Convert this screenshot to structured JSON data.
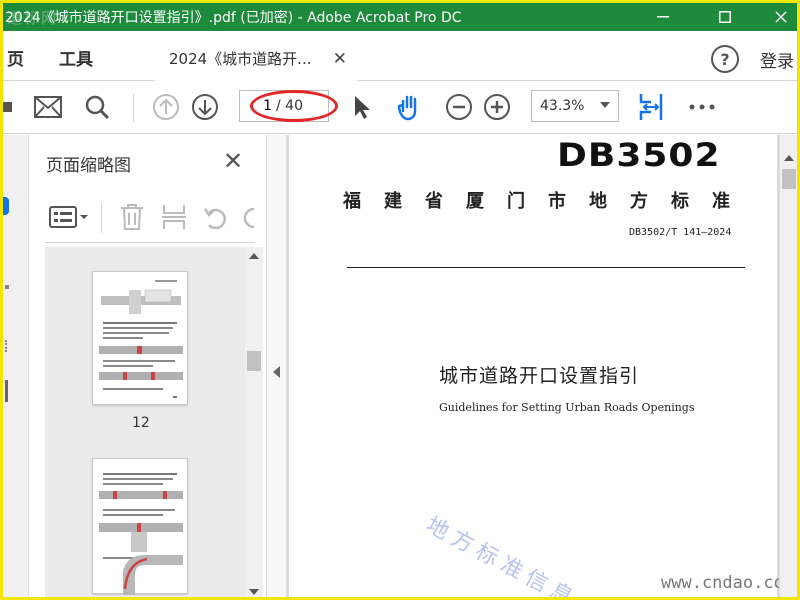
{
  "window": {
    "title": "2024《城市道路开口设置指引》.pdf  (已加密)  - Adobe Acrobat Pro DC",
    "watermark": "道标网"
  },
  "menu": {
    "items": [
      "页",
      "工具"
    ],
    "tab_label": "2024《城市道路开...",
    "login_label": "登录",
    "help_label": "?"
  },
  "toolbar": {
    "current_page": "1",
    "page_total": "/ 40",
    "zoom": "43.3%"
  },
  "panel": {
    "title": "页面缩略图",
    "thumbnails": [
      {
        "label": "12"
      },
      {
        "label": ""
      }
    ]
  },
  "document": {
    "code": "DB3502",
    "region_title": "福建省厦门市地方标准",
    "std_number": "DB3502/T 141—2024",
    "title_cn": "城市道路开口设置指引",
    "title_en": "Guidelines for Setting Urban Roads Openings",
    "watermark": "地方标准信息",
    "url": "www.cndao.com"
  },
  "colors": {
    "titlebar": "#1e8a3c",
    "frame": "#f2e600",
    "accent": "#1473e6",
    "annotation": "#e32626"
  },
  "icons": [
    "mail-icon",
    "search-icon",
    "prev-page-icon",
    "next-page-icon",
    "select-cursor-icon",
    "hand-icon",
    "zoom-out-icon",
    "zoom-in-icon",
    "fit-page-icon",
    "more-icon"
  ]
}
